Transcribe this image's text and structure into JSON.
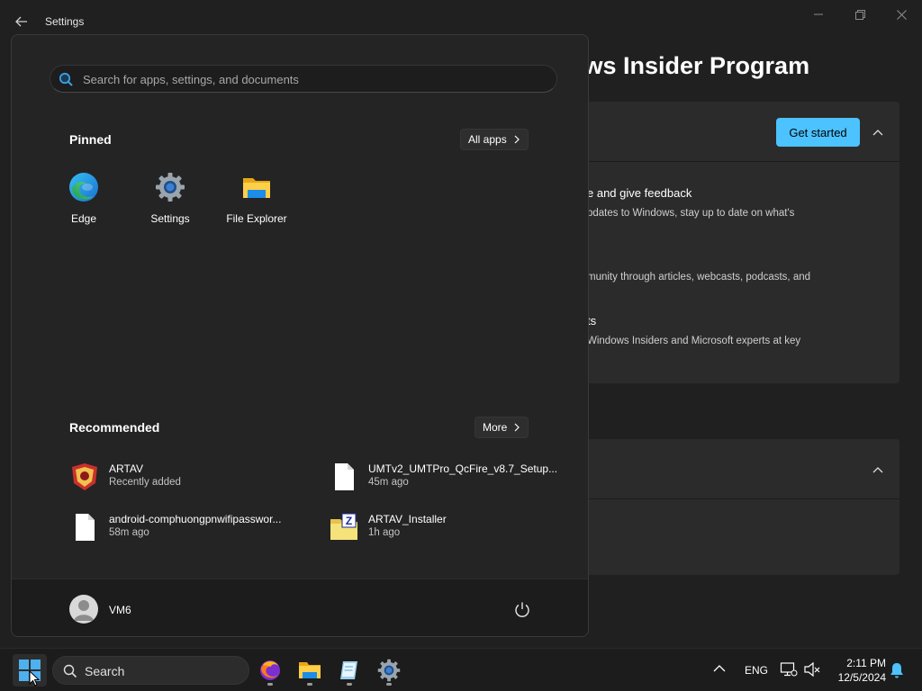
{
  "window": {
    "title": "Settings",
    "heading": "ows Insider Program"
  },
  "settings_card": {
    "get_started_label": "Get started",
    "lines": [
      {
        "title": "e and give feedback",
        "sub": "pdates to Windows, stay up to date on what's"
      },
      {
        "title": "",
        "sub": "munity through articles, webcasts, podcasts, and"
      },
      {
        "title": "ts",
        "sub": "Windows Insiders and Microsoft experts at key"
      }
    ]
  },
  "start_menu": {
    "search": {
      "placeholder": "Search for apps, settings, and documents",
      "value": ""
    },
    "pinned": {
      "title": "Pinned",
      "all_apps_label": "All apps",
      "apps": [
        {
          "label": "Edge",
          "icon": "edge-icon"
        },
        {
          "label": "Settings",
          "icon": "settings-gear-icon"
        },
        {
          "label": "File Explorer",
          "icon": "folder-icon"
        }
      ]
    },
    "recommended": {
      "title": "Recommended",
      "more_label": "More",
      "items": [
        {
          "name": "ARTAV",
          "time": "Recently added",
          "icon": "artav-app-icon"
        },
        {
          "name": "UMTv2_UMTPro_QcFire_v8.7_Setup...",
          "time": "45m ago",
          "icon": "file-icon"
        },
        {
          "name": "android-comphuongpnwifipasswor...",
          "time": "58m ago",
          "icon": "file-icon"
        },
        {
          "name": "ARTAV_Installer",
          "time": "1h ago",
          "icon": "zip-archive-icon"
        }
      ]
    },
    "user": {
      "name": "VM6"
    }
  },
  "taskbar": {
    "search_label": "Search",
    "apps": [
      "firefox-icon",
      "file-explorer-icon",
      "notepad-icon",
      "settings-icon"
    ],
    "language": "ENG",
    "time": "2:11 PM",
    "date": "12/5/2024"
  },
  "colors": {
    "accent": "#4cc2ff",
    "background": "#202020",
    "start_bg": "#242424"
  }
}
